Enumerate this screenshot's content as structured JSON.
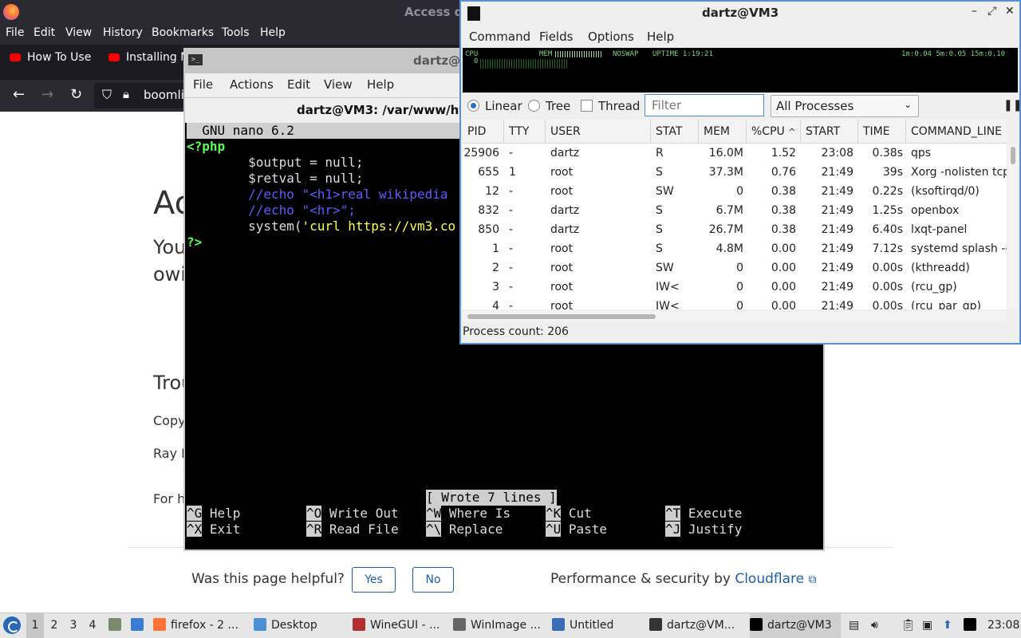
{
  "firefox": {
    "title": "Access d",
    "menu": [
      "File",
      "Edit",
      "View",
      "History",
      "Bookmarks",
      "Tools",
      "Help"
    ],
    "tabs": [
      "How To Use",
      "Installing M"
    ],
    "url": "boomli",
    "page": {
      "heading": "Ac",
      "line1": "You",
      "line2": "owi",
      "heading2": "Trou",
      "small1": "Copy",
      "small2": "Ray I",
      "small3": "For h",
      "helpful": "Was this page helpful?",
      "yes": "Yes",
      "no": "No",
      "perf_prefix": "Performance & security by",
      "perf_link": "Cloudflare",
      "ext_icon": "⧉"
    }
  },
  "terminal": {
    "window_title": "dartz@VM",
    "menu": [
      "File",
      "Actions",
      "Edit",
      "View",
      "Help"
    ],
    "tab_title": "dartz@VM3: /var/www/html",
    "nano_header": "  GNU nano 6.2",
    "code": {
      "l1": "<?php",
      "l2_indent": "        ",
      "l2": "$output = null;",
      "l3": "$retval = null;",
      "l4": "//echo \"<h1>real wikipedia",
      "l5": "//echo \"<hr>\";",
      "l6_fn": "system(",
      "l6_str": "'curl https://vm3.co",
      "l7": "?>"
    },
    "status": "[ Wrote 7 lines ]",
    "shortcuts": [
      {
        "key": "^G",
        "label": " Help"
      },
      {
        "key": "^O",
        "label": " Write Out"
      },
      {
        "key": "^W",
        "label": " Where Is"
      },
      {
        "key": "^K",
        "label": " Cut"
      },
      {
        "key": "^T",
        "label": " Execute"
      },
      {
        "key": "^X",
        "label": " Exit"
      },
      {
        "key": "^R",
        "label": " Read File"
      },
      {
        "key": "^\\",
        "label": " Replace"
      },
      {
        "key": "^U",
        "label": " Paste"
      },
      {
        "key": "^J",
        "label": " Justify"
      }
    ]
  },
  "qps": {
    "title": "dartz@VM3",
    "menu": [
      "Command",
      "Fields",
      "Options",
      "Help"
    ],
    "graph": {
      "cpu": "CPU",
      "zero": "0",
      "mem": "MEM",
      "noswap": "NOSWAP",
      "uptime": "UPTIME 1:19:21",
      "load": "1m:0.04 5m:0.05 15m:0.10"
    },
    "view_modes": [
      "Linear",
      "Tree"
    ],
    "thread_label": "Thread",
    "filter_placeholder": "Filter",
    "process_filter": "All Processes",
    "sort_indicator": "^",
    "columns": [
      "PID",
      "TTY",
      "USER",
      "STAT",
      "MEM",
      "%CPU",
      "START",
      "TIME",
      "COMMAND_LINE"
    ],
    "rows": [
      [
        "25906",
        "-",
        "dartz",
        "R",
        "16.0M",
        "1.52",
        "23:08",
        "0.38s",
        "qps"
      ],
      [
        "655",
        "1",
        "root",
        "S",
        "37.3M",
        "0.76",
        "21:49",
        "39s",
        "Xorg -nolisten tcp"
      ],
      [
        "12",
        "-",
        "root",
        "SW",
        "0",
        "0.38",
        "21:49",
        "0.22s",
        "(ksoftirqd/0)"
      ],
      [
        "832",
        "-",
        "dartz",
        "S",
        "6.7M",
        "0.38",
        "21:49",
        "1.25s",
        "openbox"
      ],
      [
        "850",
        "-",
        "dartz",
        "S",
        "26.7M",
        "0.38",
        "21:49",
        "6.40s",
        "lxqt-panel"
      ],
      [
        "1",
        "-",
        "root",
        "S",
        "4.8M",
        "0.00",
        "21:49",
        "7.12s",
        "systemd splash --"
      ],
      [
        "2",
        "-",
        "root",
        "SW",
        "0",
        "0.00",
        "21:49",
        "0.00s",
        "(kthreadd)"
      ],
      [
        "3",
        "-",
        "root",
        "IW<",
        "0",
        "0.00",
        "21:49",
        "0.00s",
        "(rcu_gp)"
      ],
      [
        "4",
        "-",
        "root",
        "IW<",
        "0",
        "0.00",
        "21:49",
        "0.00s",
        "(rcu_par_gp)"
      ]
    ],
    "status": "Process count: 206"
  },
  "taskbar": {
    "workspaces": [
      "1",
      "2",
      "3",
      "4"
    ],
    "tasks": [
      {
        "label": "firefox - 2 ...",
        "icon": "firefox-icon",
        "color": "#ff7139"
      },
      {
        "label": "Desktop",
        "icon": "folder-icon",
        "color": "#4a90d9"
      },
      {
        "label": "WineGUI - ...",
        "icon": "wine-icon",
        "color": "#b03030"
      },
      {
        "label": "WinImage ...",
        "icon": "winimage-icon",
        "color": "#666666"
      },
      {
        "label": "Untitled",
        "icon": "text-editor-icon",
        "color": "#3a6db5"
      },
      {
        "label": "dartz@VM...",
        "icon": "terminal-icon",
        "color": "#333333"
      },
      {
        "label": "dartz@VM3",
        "icon": "qps-icon",
        "color": "#000000"
      }
    ],
    "clock": "23:08"
  }
}
